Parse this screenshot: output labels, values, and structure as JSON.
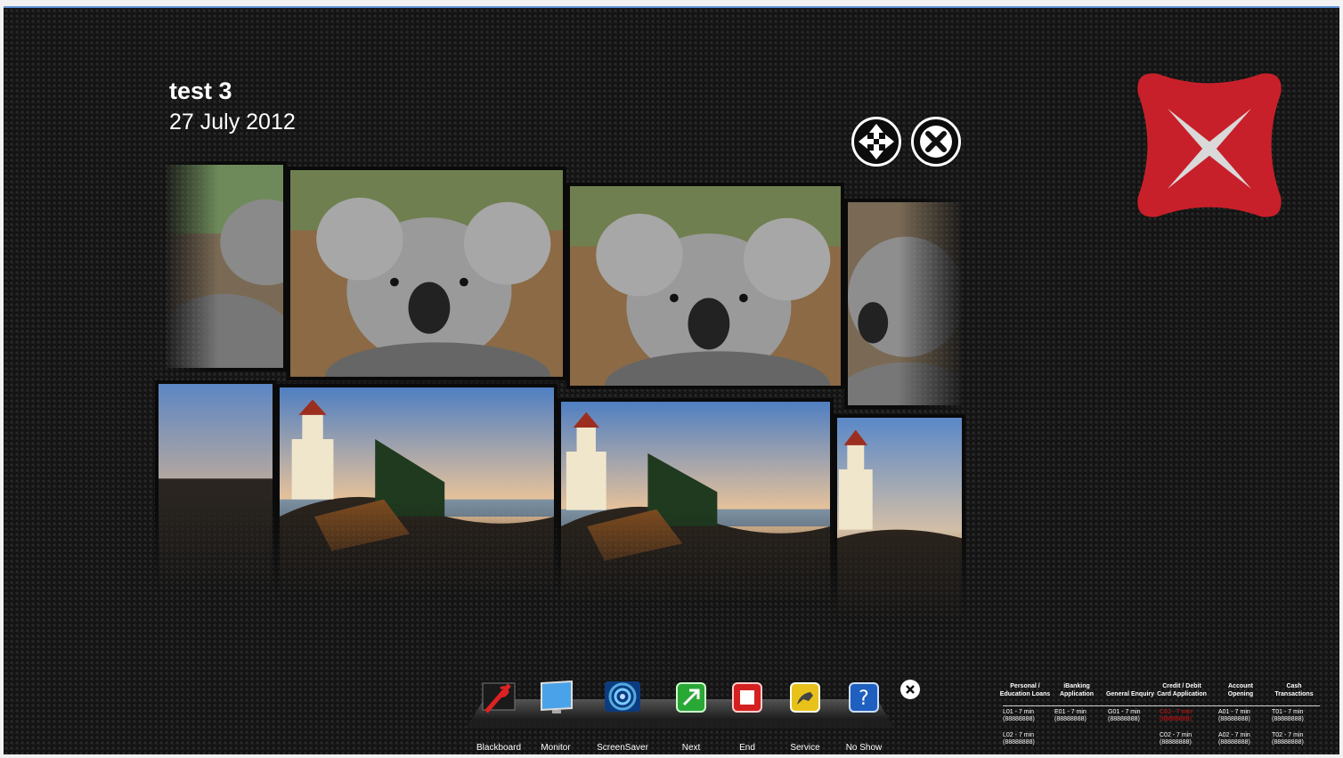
{
  "header": {
    "title": "test 3",
    "date": "27 July 2012"
  },
  "controls": {
    "move_icon": "move-arrows-icon",
    "close_icon": "close-x-icon"
  },
  "logo": {
    "name": "bank-logo",
    "color": "#c8202a"
  },
  "gallery": {
    "top_row": [
      "koala",
      "koala",
      "koala",
      "koala"
    ],
    "bottom_row": [
      "lighthouse",
      "lighthouse",
      "lighthouse",
      "lighthouse"
    ]
  },
  "dock": {
    "items": [
      {
        "label": "Blackboard",
        "icon": "blackboard-icon"
      },
      {
        "label": "Monitor",
        "icon": "monitor-icon"
      },
      {
        "label": "ScreenSaver",
        "icon": "screensaver-icon"
      },
      {
        "label": "Next",
        "icon": "next-icon"
      },
      {
        "label": "End",
        "icon": "end-icon"
      },
      {
        "label": "Service",
        "icon": "service-icon"
      },
      {
        "label": "No Show",
        "icon": "no-show-icon"
      }
    ]
  },
  "queue": {
    "columns": [
      {
        "header": "Personal / Education Loans",
        "entries": [
          {
            "ticket": "L01 - 7 min",
            "sub": "(88888888)"
          },
          {
            "ticket": "L02 - 7 min",
            "sub": "(88888888)"
          }
        ]
      },
      {
        "header": "iBanking Application",
        "entries": [
          {
            "ticket": "E01 - 7 min",
            "sub": "(88888888)"
          }
        ]
      },
      {
        "header": "General Enquiry",
        "entries": [
          {
            "ticket": "G01 - 7 min",
            "sub": "(88888888)"
          }
        ]
      },
      {
        "header": "Credit / Debit Card Application",
        "entries": [
          {
            "ticket": "C01 - 7 min",
            "sub": "(88888888)",
            "highlight": true
          },
          {
            "ticket": "C02 - 7 min",
            "sub": "(88888888)"
          }
        ]
      },
      {
        "header": "Account Opening",
        "entries": [
          {
            "ticket": "A01 - 7 min",
            "sub": "(88888888)"
          },
          {
            "ticket": "A02 - 7 min",
            "sub": "(88888888)"
          }
        ]
      },
      {
        "header": "Cash Transactions",
        "entries": [
          {
            "ticket": "T01 - 7 min",
            "sub": "(88888888)"
          },
          {
            "ticket": "T02 - 7 min",
            "sub": "(88888888)"
          }
        ]
      }
    ]
  }
}
